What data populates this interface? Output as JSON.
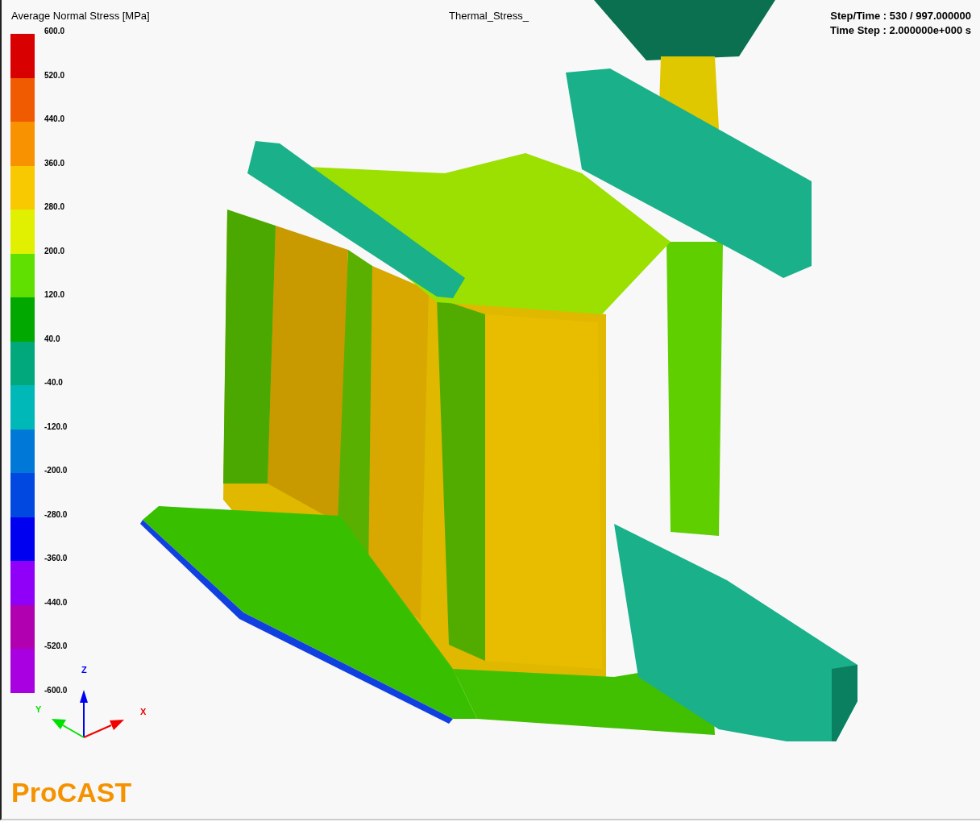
{
  "viewport": {
    "title": "Thermal_Stress_",
    "step_time": "Step/Time : 530 / 997.000000",
    "time_step": "Time Step : 2.000000e+000 s"
  },
  "legend": {
    "title": "Average Normal Stress [MPa]",
    "bands": [
      {
        "color": "#d80000"
      },
      {
        "color": "#f05a00"
      },
      {
        "color": "#f89200"
      },
      {
        "color": "#f8c800"
      },
      {
        "color": "#e0f000"
      },
      {
        "color": "#60e000"
      },
      {
        "color": "#00a800"
      },
      {
        "color": "#00a87c"
      },
      {
        "color": "#00b8b8"
      },
      {
        "color": "#0078d8"
      },
      {
        "color": "#0048e0"
      },
      {
        "color": "#0000f0"
      },
      {
        "color": "#9000f8"
      },
      {
        "color": "#b000b0"
      },
      {
        "color": "#a800e0"
      }
    ],
    "labels": [
      "600.0",
      "520.0",
      "440.0",
      "360.0",
      "280.0",
      "200.0",
      "120.0",
      "40.0",
      "-40.0",
      "-120.0",
      "-200.0",
      "-280.0",
      "-360.0",
      "-440.0",
      "-520.0",
      "-600.0"
    ]
  },
  "axes": [
    {
      "label": "Z",
      "color": "#0000f0"
    },
    {
      "label": "Y",
      "color": "#00e000"
    },
    {
      "label": "X",
      "color": "#f00000"
    }
  ],
  "logo": "ProCAST"
}
